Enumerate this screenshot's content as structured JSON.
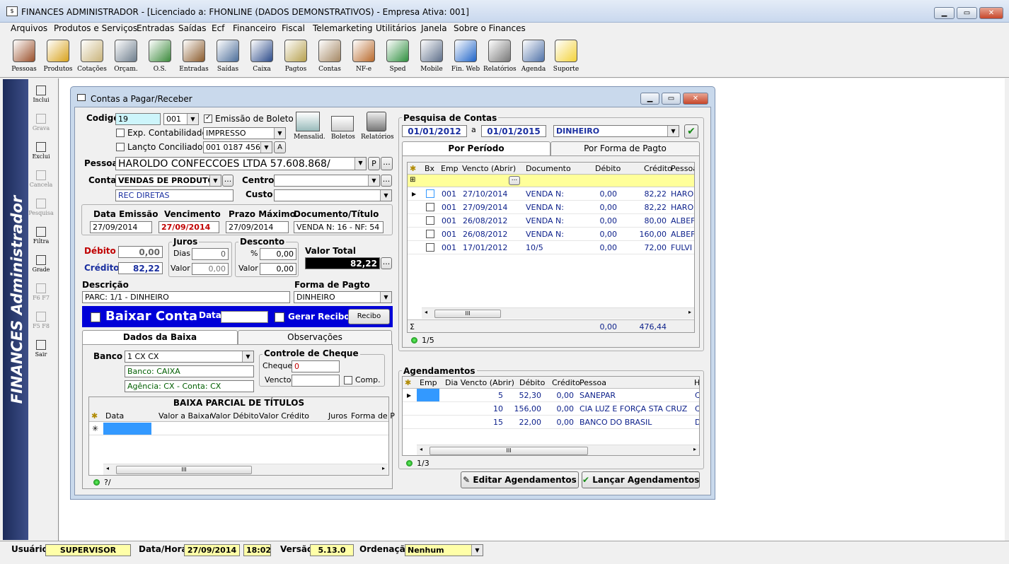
{
  "app": {
    "title": "FINANCES ADMINISTRADOR - [Licenciado a: FHONLINE (DADOS DEMONSTRATIVOS) - Empresa Ativa: 001]",
    "brand": "FINANCES Administrador"
  },
  "menu": [
    "Arquivos",
    "Produtos e Serviços",
    "Entradas",
    "Saídas",
    "Ecf",
    "Financeiro",
    "Fiscal",
    "Telemarketing",
    "Utilitários",
    "Janela",
    "Sobre o Finances"
  ],
  "toolbar": [
    {
      "label": "Pessoas",
      "icon": "people-icon",
      "color": "#9a4f2a"
    },
    {
      "label": "Produtos",
      "icon": "boxes-icon",
      "color": "#d8a21c"
    },
    {
      "label": "Cotações",
      "icon": "quote-icon",
      "color": "#c9b37a"
    },
    {
      "label": "Orçam.",
      "icon": "calculator-icon",
      "color": "#6d7d8c"
    },
    {
      "label": "O.S.",
      "icon": "service-order-icon",
      "color": "#3b8a3b"
    },
    {
      "label": "Entradas",
      "icon": "truck-in-icon",
      "color": "#8a5a2b"
    },
    {
      "label": "Saídas",
      "icon": "person-out-icon",
      "color": "#4c6e9a"
    },
    {
      "label": "Caixa",
      "icon": "cash-register-icon",
      "color": "#2c4b8a"
    },
    {
      "label": "Pagtos",
      "icon": "payment-icon",
      "color": "#b6a04d"
    },
    {
      "label": "Contas",
      "icon": "accounts-icon",
      "color": "#a48763"
    },
    {
      "label": "NF-e",
      "icon": "nfe-icon",
      "color": "#b8692b"
    },
    {
      "label": "Sped",
      "icon": "sped-icon",
      "color": "#2f8f3f"
    },
    {
      "label": "Mobile",
      "icon": "mobile-icon",
      "color": "#5e6f8a"
    },
    {
      "label": "Fin. Web",
      "icon": "web-icon",
      "color": "#1f64c8"
    },
    {
      "label": "Relatórios",
      "icon": "printer-icon",
      "color": "#777777"
    },
    {
      "label": "Agenda",
      "icon": "calendar-icon",
      "color": "#5072a8"
    },
    {
      "label": "Suporte",
      "icon": "lightbulb-icon",
      "color": "#f3d23a"
    }
  ],
  "sidebar": [
    {
      "label": "Inclui",
      "enabled": true
    },
    {
      "label": "Grava",
      "enabled": false
    },
    {
      "label": "Exclui",
      "enabled": true
    },
    {
      "label": "Cancela",
      "enabled": false
    },
    {
      "label": "Pesquisa",
      "enabled": false
    },
    {
      "label": "Filtra",
      "enabled": true
    },
    {
      "label": "Grade",
      "enabled": true
    },
    {
      "label": "F6   F7",
      "enabled": false
    },
    {
      "label": "F5   F8",
      "enabled": false
    },
    {
      "label": "Sair",
      "enabled": true
    }
  ],
  "window": {
    "title": "Contas a Pagar/Receber"
  },
  "form": {
    "codigo_label": "Codigo",
    "codigo": "19",
    "empresa": "001",
    "emissao_boleto_label": "Emissão de Boleto",
    "exp_contab_label": "Exp. Contabilidade",
    "impresso": "IMPRESSO",
    "lancto_conc_label": "Lançto Conciliado",
    "conta_bancaria": "001  0187  4566",
    "a_btn": "A",
    "mensalid": "Mensalid.",
    "boletos": "Boletos",
    "relatorios": "Relatórios",
    "pessoa_label": "Pessoa",
    "pessoa": "HAROLDO CONFECCOES LTDA  57.608.868/",
    "p_btn": "P",
    "conta_label": "Conta",
    "conta": "VENDAS DE PRODUTO",
    "conta_sub": "REC DIRETAS",
    "centro_label": "Centro",
    "custo_label": "Custo",
    "data_emissao_label": "Data Emissão",
    "data_emissao": "27/09/2014",
    "vencimento_label": "Vencimento",
    "vencimento": "27/09/2014",
    "prazo_label": "Prazo Máximo",
    "prazo": "27/09/2014",
    "documento_label": "Documento/Título",
    "documento": "VENDA N: 16 - NF: 54",
    "debito_label": "Débito",
    "debito": "0,00",
    "credito_label": "Crédito",
    "credito": "82,22",
    "juros_label": "Juros",
    "dias_label": "Dias",
    "dias": "0",
    "valor_label": "Valor",
    "juros_valor": "0,00",
    "desconto_label": "Desconto",
    "pct_label": "%",
    "desc_pct": "0,00",
    "desc_valor": "0,00",
    "valor_total_label": "Valor Total",
    "valor_total": "82,22",
    "descricao_label": "Descrição",
    "descricao": "PARC: 1/1 - DINHEIRO",
    "forma_label": "Forma de Pagto",
    "forma": "DINHEIRO",
    "baixar_label": "Baixar Conta",
    "data_label": "Data",
    "gerar_recibo_label": "Gerar Recibo",
    "recibo_btn": "Recibo"
  },
  "baixa_tabs": [
    "Dados da Baixa",
    "Observações"
  ],
  "baixa": {
    "banco_label": "Banco",
    "banco": "1  CX  CX",
    "banco_nome": "Banco: CAIXA",
    "agencia": "Agência: CX - Conta: CX",
    "cheque_group": "Controle de Cheque",
    "cheque_label": "Cheque",
    "cheque": "0",
    "vencto_label": "Vencto",
    "comp_label": "Comp.",
    "parcial_title": "BAIXA PARCIAL DE TÍTULOS",
    "columns": [
      "Data",
      "Valor a Baixar",
      "Valor Débito",
      "Valor Crédito",
      "Juros",
      "Forma de P"
    ],
    "footer": "?/"
  },
  "pesquisa": {
    "title": "Pesquisa de Contas",
    "de": "01/01/2012",
    "a_label": "a",
    "ate": "01/01/2015",
    "forma": "DINHEIRO",
    "tabs": [
      "Por Período",
      "Por Forma de Pagto"
    ],
    "columns": [
      "Bx",
      "Emp",
      "Vencto (Abrir)",
      "Documento",
      "Débito",
      "Crédito",
      "Pessoa"
    ],
    "rows": [
      {
        "emp": "001",
        "vencto": "27/10/2014",
        "doc": "VENDA N:",
        "debito": "0,00",
        "credito": "82,22",
        "pessoa": "HARO"
      },
      {
        "emp": "001",
        "vencto": "27/09/2014",
        "doc": "VENDA N:",
        "debito": "0,00",
        "credito": "82,22",
        "pessoa": "HARO"
      },
      {
        "emp": "001",
        "vencto": "26/08/2012",
        "doc": "VENDA N:",
        "debito": "0,00",
        "credito": "80,00",
        "pessoa": "ALBEF"
      },
      {
        "emp": "001",
        "vencto": "26/08/2012",
        "doc": "VENDA N:",
        "debito": "0,00",
        "credito": "160,00",
        "pessoa": "ALBEF"
      },
      {
        "emp": "001",
        "vencto": "17/01/2012",
        "doc": "10/5",
        "debito": "0,00",
        "credito": "72,00",
        "pessoa": "FULVI"
      }
    ],
    "total_debito": "0,00",
    "total_credito": "476,44",
    "footer": "1/5"
  },
  "agendamentos": {
    "title": "Agendamentos",
    "columns": [
      "Emp",
      "Dia Vencto (Abrir)",
      "Débito",
      "Crédito",
      "Pessoa",
      "H"
    ],
    "rows": [
      {
        "dia": "5",
        "debito": "52,30",
        "credito": "0,00",
        "pessoa": "SANEPAR",
        "h": "C"
      },
      {
        "dia": "10",
        "debito": "156,00",
        "credito": "0,00",
        "pessoa": "CIA LUZ E FORÇA STA CRUZ",
        "h": "C"
      },
      {
        "dia": "15",
        "debito": "22,00",
        "credito": "0,00",
        "pessoa": "BANCO DO BRASIL",
        "h": "D"
      }
    ],
    "footer": "1/3",
    "editar_btn": "Editar Agendamentos",
    "lancar_btn": "Lançar Agendamentos"
  },
  "status": {
    "usuario_label": "Usuário",
    "usuario": "SUPERVISOR",
    "datahora_label": "Data/Hora",
    "data": "27/09/2014",
    "hora": "18:02",
    "versao_label": "Versão",
    "versao": "5.13.0",
    "ordenacao_label": "Ordenação",
    "ordenacao": "Nenhum"
  }
}
